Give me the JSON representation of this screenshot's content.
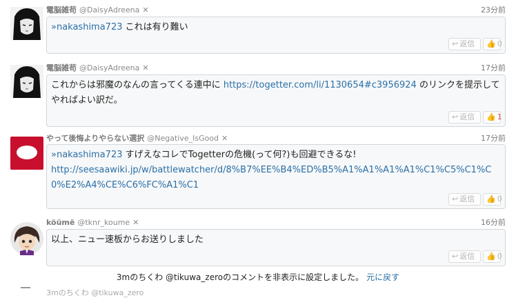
{
  "comments": [
    {
      "name": "電脳雑苟",
      "handle": "@DaisyAdreena",
      "close": "✕",
      "time": "23分前",
      "text_link": "»nakashima723",
      "text": " これは有り難い",
      "reply": "返信",
      "likes": "0",
      "avatar_icon": "dark-hair-girl-avatar"
    },
    {
      "name": "電脳雑苟",
      "handle": "@DaisyAdreena",
      "close": "✕",
      "time": "17分前",
      "text_a": "これからは邪魔のなんの言ってくる連中に ",
      "text_link": "https://togetter.com/li/1130654#c3956924",
      "text_b": " のリンクを提示してやればよい訳だ。",
      "reply": "返信",
      "likes": "1",
      "avatar_icon": "dark-hair-girl-avatar"
    },
    {
      "name": "やって後悔よりやらない選択",
      "handle": "@Negative_IsGood",
      "close": "✕",
      "time": "17分前",
      "text_link": "»nakashima723",
      "text_a": " すげえなコレでTogetterの危機(って何?)も回避できるな!",
      "url": "http://seesaawiki.jp/w/battlewatcher/d/8%B7%EE%B4%ED%B5%A1%A1%A1%A1%C1%C5%C1%C0%E2%A4%CE%C6%FC%A1%C1",
      "reply": "返信",
      "likes": "0",
      "avatar_icon": "red-speech-bubble-avatar"
    },
    {
      "name": "köümë",
      "handle": "@tknr_koume",
      "close": "✕",
      "time": "16分前",
      "text": "以上、ニュー速板からお送りしました",
      "reply": "返信",
      "likes": "0",
      "avatar_icon": "anime-character-avatar"
    }
  ],
  "notice": {
    "text": "3mのちくわ @tikuwa_zeroのコメントを非表示に設定しました。",
    "undo": "元に戻す"
  },
  "partial": "3mのちくわ @tikuwa_zero"
}
